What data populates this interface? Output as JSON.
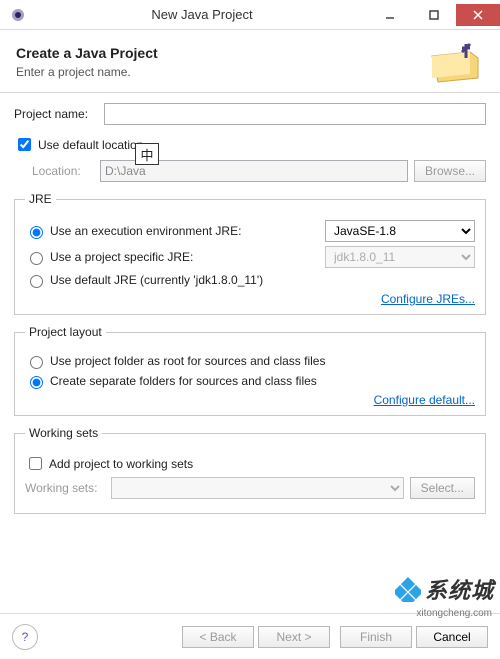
{
  "window": {
    "title": "New Java Project"
  },
  "header": {
    "title": "Create a Java Project",
    "subtitle": "Enter a project name."
  },
  "project": {
    "name_label": "Project name:",
    "name_value": "",
    "use_default_label": "Use default location",
    "use_default_checked": true,
    "location_label": "Location:",
    "location_value": "D:\\Java",
    "browse_label": "Browse..."
  },
  "jre": {
    "legend": "JRE",
    "opt_env_label": "Use an execution environment JRE:",
    "opt_env_value": "JavaSE-1.8",
    "opt_specific_label": "Use a project specific JRE:",
    "opt_specific_value": "jdk1.8.0_11",
    "opt_default_label": "Use default JRE (currently 'jdk1.8.0_11')",
    "selected": "env",
    "configure_link": "Configure JREs..."
  },
  "layout": {
    "legend": "Project layout",
    "opt_root_label": "Use project folder as root for sources and class files",
    "opt_separate_label": "Create separate folders for sources and class files",
    "selected": "separate",
    "configure_link": "Configure default..."
  },
  "workingsets": {
    "legend": "Working sets",
    "add_label": "Add project to working sets",
    "add_checked": false,
    "ws_label": "Working sets:",
    "ws_value": "",
    "select_label": "Select..."
  },
  "footer": {
    "back": "< Back",
    "next": "Next >",
    "finish": "Finish",
    "cancel": "Cancel"
  },
  "ime_badge": "中",
  "watermark": {
    "site": "xitongcheng.com",
    "brand": "系统城"
  }
}
